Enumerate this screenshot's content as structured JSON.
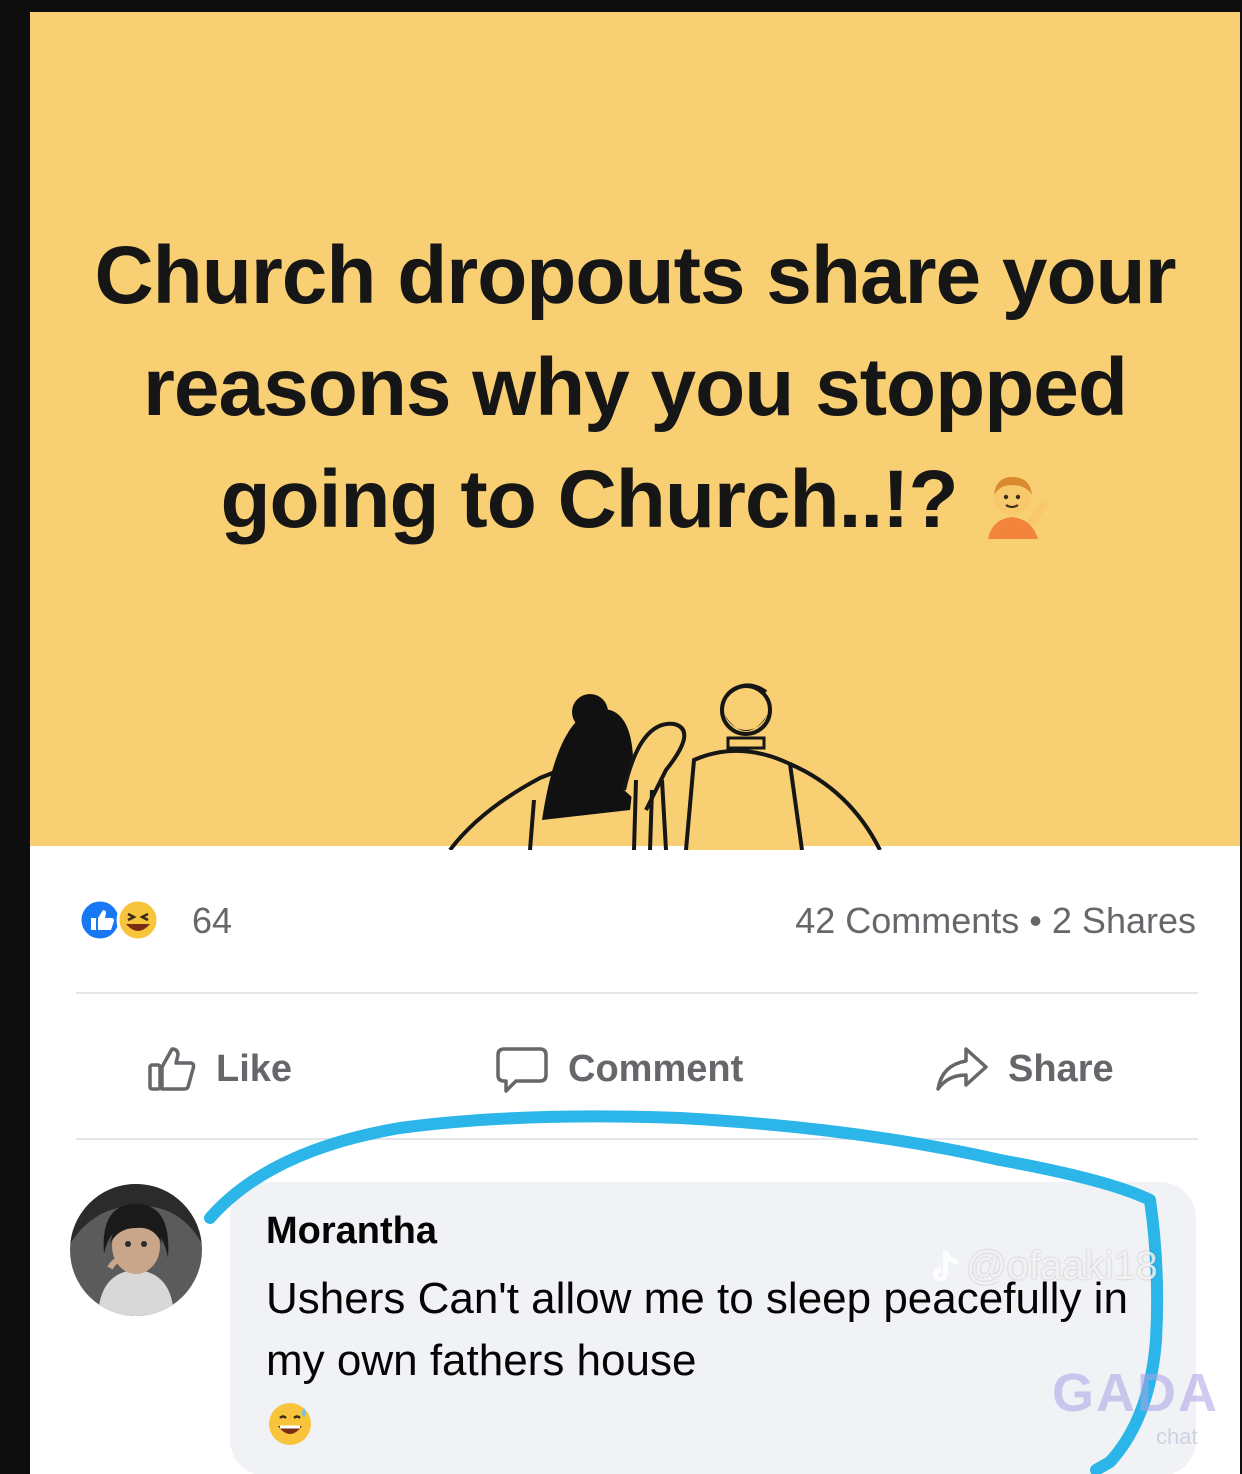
{
  "post": {
    "title": "Church dropouts share your reasons why you stopped going to Church..!?",
    "title_emoji": "person-tipping-hand-emoji"
  },
  "reactions": {
    "icons": [
      "like-icon",
      "haha-icon"
    ],
    "count": "64"
  },
  "engagement": {
    "comments_shares": "42 Comments • 2 Shares"
  },
  "actions": {
    "like_label": "Like",
    "comment_label": "Comment",
    "share_label": "Share"
  },
  "comment": {
    "author": "Morantha",
    "text": "Ushers Can't allow me to sleep peacefully in my own fathers house",
    "emoji": "grinning-sweat-emoji"
  },
  "watermark": {
    "handle": "@ofaaki18",
    "logo": "GADA",
    "domain": "chat"
  },
  "colors": {
    "card_background": "#f8cf72",
    "highlight_stroke": "#2bb5e8",
    "like_blue": "#1877f2",
    "muted_text": "#65676b"
  }
}
